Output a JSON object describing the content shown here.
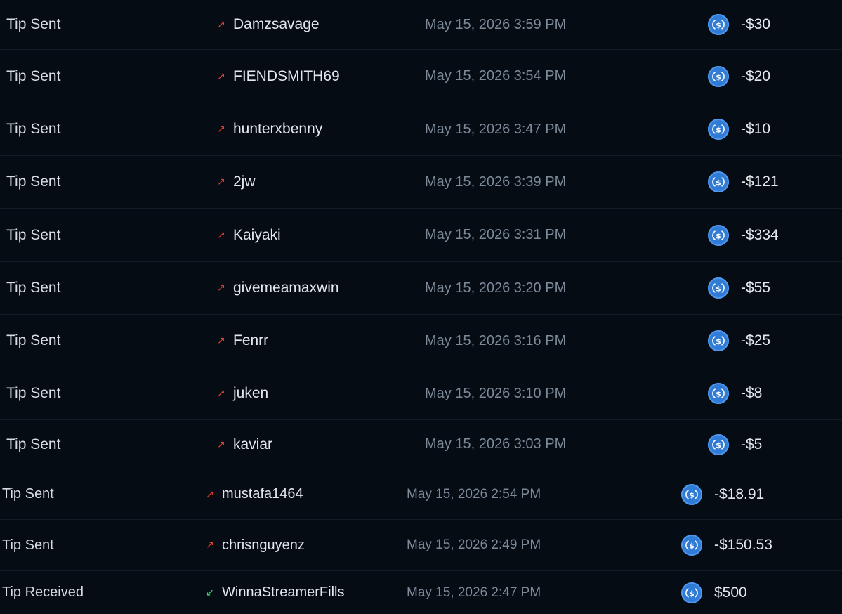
{
  "icons": {
    "sent_arrow": "arrow-up-right-icon",
    "received_arrow": "arrow-down-left-icon",
    "coin": "usdc-coin-icon"
  },
  "colors": {
    "background": "#050c14",
    "sent_arrow": "#e0412e",
    "received_arrow": "#3bd16f",
    "coin": "#2f7bd6"
  },
  "transactions": [
    {
      "type": "Tip Sent",
      "direction": "sent",
      "user": "Damzsavage",
      "date": "May 15, 2026 3:59 PM",
      "amount": "-$30"
    },
    {
      "type": "Tip Sent",
      "direction": "sent",
      "user": "FIENDSMITH69",
      "date": "May 15, 2026 3:54 PM",
      "amount": "-$20"
    },
    {
      "type": "Tip Sent",
      "direction": "sent",
      "user": "hunterxbenny",
      "date": "May 15, 2026 3:47 PM",
      "amount": "-$10"
    },
    {
      "type": "Tip Sent",
      "direction": "sent",
      "user": "2jw",
      "date": "May 15, 2026 3:39 PM",
      "amount": "-$121"
    },
    {
      "type": "Tip Sent",
      "direction": "sent",
      "user": "Kaiyaki",
      "date": "May 15, 2026 3:31 PM",
      "amount": "-$334"
    },
    {
      "type": "Tip Sent",
      "direction": "sent",
      "user": "givemeamaxwin",
      "date": "May 15, 2026 3:20 PM",
      "amount": "-$55"
    },
    {
      "type": "Tip Sent",
      "direction": "sent",
      "user": "Fenrr",
      "date": "May 15, 2026 3:16 PM",
      "amount": "-$25"
    },
    {
      "type": "Tip Sent",
      "direction": "sent",
      "user": "juken",
      "date": "May 15, 2026 3:10 PM",
      "amount": "-$8"
    },
    {
      "type": "Tip Sent",
      "direction": "sent",
      "user": "kaviar",
      "date": "May 15, 2026 3:03 PM",
      "amount": "-$5"
    },
    {
      "type": "Tip Sent",
      "direction": "sent",
      "user": "mustafa1464",
      "date": "May 15, 2026 2:54 PM",
      "amount": "-$18.91"
    },
    {
      "type": "Tip Sent",
      "direction": "sent",
      "user": "chrisnguyenz",
      "date": "May 15, 2026 2:49 PM",
      "amount": "-$150.53"
    },
    {
      "type": "Tip Received",
      "direction": "received",
      "user": "WinnaStreamerFills",
      "date": "May 15, 2026 2:47 PM",
      "amount": "$500"
    }
  ]
}
